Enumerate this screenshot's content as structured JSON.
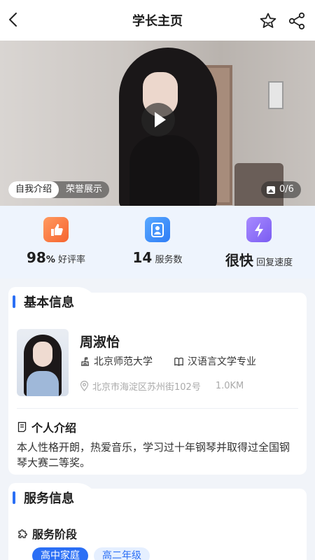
{
  "header": {
    "title": "学长主页"
  },
  "media": {
    "tabs": [
      {
        "label": "自我介绍",
        "active": true
      },
      {
        "label": "荣誉展示",
        "active": false
      }
    ],
    "counter": "0/6"
  },
  "stats": [
    {
      "value": "98",
      "unit": "%",
      "label": "好评率",
      "icon": "thumbs-up-icon",
      "color": "#f6642e"
    },
    {
      "value": "14",
      "unit": "",
      "label": "服务数",
      "icon": "user-icon",
      "color": "#2f7df6"
    },
    {
      "value": "很快",
      "unit": "",
      "label": "回复速度",
      "icon": "lightning-icon",
      "color": "#7a5cf2"
    }
  ],
  "basic_info": {
    "section_title": "基本信息",
    "name": "周淑怡",
    "university": "北京师范大学",
    "major": "汉语言文学专业",
    "address": "北京市海淀区苏州街102号",
    "distance": "1.0KM",
    "intro_title": "个人介绍",
    "intro_text": "本人性格开朗，热爱音乐，学习过十年钢琴并取得过全国钢琴大赛二等奖。"
  },
  "service_info": {
    "section_title": "服务信息",
    "stage_title": "服务阶段",
    "tags": [
      "高中家庭",
      "高二年级"
    ]
  },
  "colors": {
    "accent": "#2b6ff5",
    "stats_bg": "#eef4fd",
    "page_bg": "#f1f4f9"
  }
}
